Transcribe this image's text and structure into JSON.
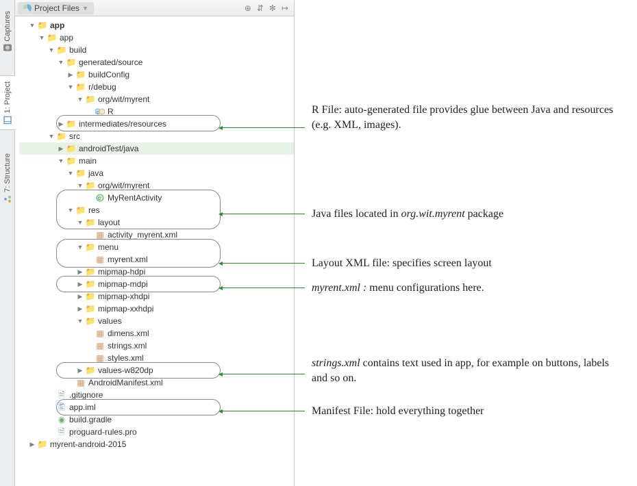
{
  "sidebarTabs": {
    "captures": "Captures",
    "project": "1: Project",
    "structure": "7: Structure"
  },
  "header": {
    "tab": "Project Files",
    "icons": {
      "target": "⊕",
      "collapse": "⇵",
      "gear": "✻",
      "hide": "↦"
    }
  },
  "tree": {
    "app1": "app",
    "app2": "app",
    "build": "build",
    "gensrc": "generated/source",
    "buildConfig": "buildConfig",
    "rdebug": "r/debug",
    "orgwit1": "org/wit/myrent",
    "r": "R",
    "intres": "intermediates/resources",
    "src": "src",
    "androidTest": "androidTest/java",
    "main": "main",
    "java": "java",
    "orgwit2": "org/wit/myrent",
    "activity": "MyRentActivity",
    "res": "res",
    "layout": "layout",
    "layoutxml": "activity_myrent.xml",
    "menu": "menu",
    "menuxml": "myrent.xml",
    "hdpi": "mipmap-hdpi",
    "mdpi": "mipmap-mdpi",
    "xhdpi": "mipmap-xhdpi",
    "xxhdpi": "mipmap-xxhdpi",
    "values": "values",
    "dimens": "dimens.xml",
    "strings": "strings.xml",
    "styles": "styles.xml",
    "valuesw": "values-w820dp",
    "manifest": "AndroidManifest.xml",
    "gitignore": ".gitignore",
    "appiml": "app.iml",
    "buildgradle": "build.gradle",
    "proguard": "proguard-rules.pro",
    "myrent2015": "myrent-android-2015"
  },
  "annotations": {
    "r": "R File: auto-generated file provides glue between Java and resources (e.g. XML, images).",
    "java_pre": "Java files located in ",
    "java_em": "org.wit.myrent",
    "java_post": " package",
    "layout": "Layout XML file: specifies screen layout",
    "menu_em": "myrent.xml :",
    "menu_post": " menu configurations here.",
    "strings_em": "strings.xml",
    "strings_post": " contains text used in app, for example on buttons, labels and so on.",
    "manifest": "Manifest File: hold everything together"
  }
}
